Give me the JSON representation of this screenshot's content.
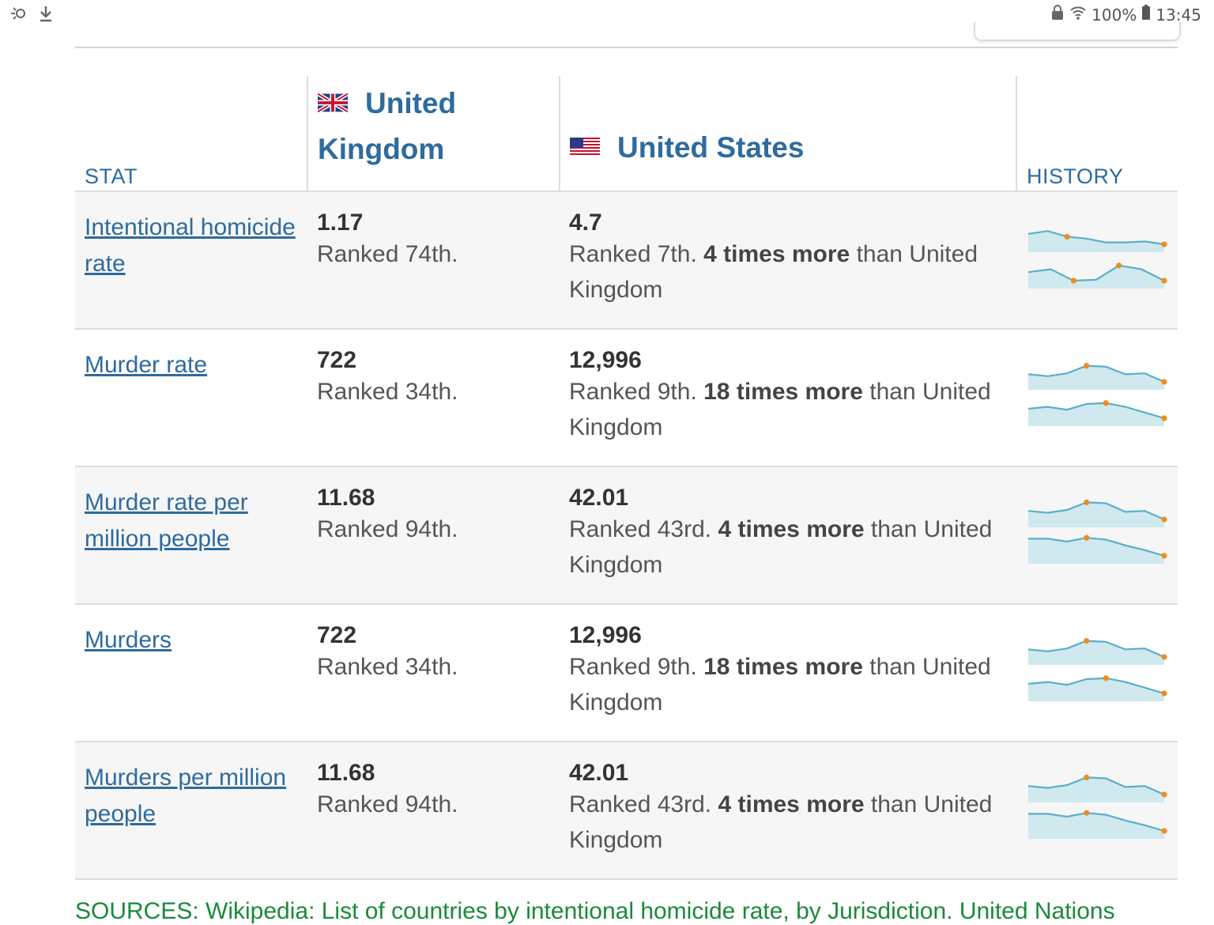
{
  "status_bar": {
    "battery": "100%",
    "time": "13:45"
  },
  "table": {
    "headers": {
      "stat": "STAT",
      "country_a": "United Kingdom",
      "country_b": "United States",
      "history": "HISTORY"
    },
    "rows": [
      {
        "stat": "Intentional homicide rate",
        "a_value": "1.17",
        "a_rank": "Ranked 74th.",
        "b_value": "4.7",
        "b_rank": "Ranked 7th.",
        "b_compare": "4 times more",
        "b_tail": "than United Kingdom",
        "spark_a": [
          0.55,
          0.7,
          0.4,
          0.3,
          0.1,
          0.1,
          0.15,
          0.0
        ],
        "spark_b": [
          0.45,
          0.6,
          0.0,
          0.05,
          0.8,
          0.6,
          0.0
        ],
        "mark_a": [
          2,
          7
        ],
        "mark_b": [
          2,
          4,
          6
        ]
      },
      {
        "stat": "Murder rate",
        "a_value": "722",
        "a_rank": "Ranked 34th.",
        "b_value": "12,996",
        "b_rank": "Ranked 9th.",
        "b_compare": "18 times more",
        "b_tail": "than United Kingdom",
        "spark_a": [
          0.4,
          0.3,
          0.45,
          0.85,
          0.8,
          0.4,
          0.45,
          0.0
        ],
        "spark_b": [
          0.5,
          0.6,
          0.45,
          0.75,
          0.8,
          0.6,
          0.3,
          0.0
        ],
        "mark_a": [
          3,
          7
        ],
        "mark_b": [
          4,
          7
        ]
      },
      {
        "stat": "Murder rate per million people",
        "a_value": "11.68",
        "a_rank": "Ranked 94th.",
        "b_value": "42.01",
        "b_rank": "Ranked 43rd.",
        "b_compare": "4 times more",
        "b_tail": "than United Kingdom",
        "spark_a": [
          0.45,
          0.35,
          0.5,
          0.9,
          0.85,
          0.4,
          0.45,
          0.0
        ],
        "spark_b": [
          0.9,
          0.9,
          0.75,
          0.95,
          0.85,
          0.55,
          0.3,
          0.0
        ],
        "mark_a": [
          3,
          7
        ],
        "mark_b": [
          3,
          7
        ]
      },
      {
        "stat": "Murders",
        "a_value": "722",
        "a_rank": "Ranked 34th.",
        "b_value": "12,996",
        "b_rank": "Ranked 9th.",
        "b_compare": "18 times more",
        "b_tail": "than United Kingdom",
        "spark_a": [
          0.4,
          0.3,
          0.45,
          0.85,
          0.8,
          0.4,
          0.45,
          0.0
        ],
        "spark_b": [
          0.5,
          0.6,
          0.45,
          0.75,
          0.8,
          0.6,
          0.3,
          0.0
        ],
        "mark_a": [
          3,
          7
        ],
        "mark_b": [
          4,
          7
        ]
      },
      {
        "stat": "Murders per million people",
        "a_value": "11.68",
        "a_rank": "Ranked 94th.",
        "b_value": "42.01",
        "b_rank": "Ranked 43rd.",
        "b_compare": "4 times more",
        "b_tail": "than United Kingdom",
        "spark_a": [
          0.45,
          0.35,
          0.5,
          0.9,
          0.85,
          0.4,
          0.45,
          0.0
        ],
        "spark_b": [
          0.9,
          0.9,
          0.75,
          0.95,
          0.85,
          0.55,
          0.3,
          0.0
        ],
        "mark_a": [
          3,
          7
        ],
        "mark_b": [
          3,
          7
        ]
      }
    ]
  },
  "footer": {
    "sources_text": "SOURCES: Wikipedia: List of countries by intentional homicide rate, by Jurisdiction. United Nations"
  },
  "colors": {
    "link": "#2e6b9e",
    "spark_line": "#5aaecc",
    "spark_fill": "#cfe9ee",
    "spark_marker": "#f28c18",
    "sources": "#1a8a3a"
  }
}
